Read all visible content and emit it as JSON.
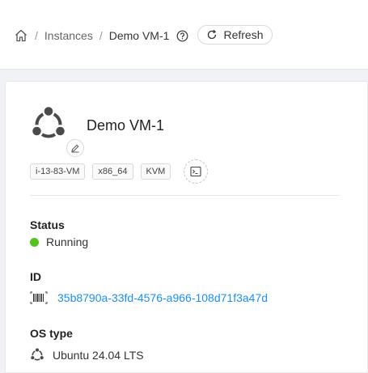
{
  "breadcrumb": {
    "home_icon": "home-icon",
    "items": [
      "Instances",
      "Demo VM-1"
    ],
    "separator": "/"
  },
  "header": {
    "help_icon": "question-circle-icon",
    "refresh_label": "Refresh",
    "refresh_icon": "reload-icon"
  },
  "instance": {
    "name": "Demo VM-1",
    "os_icon": "ubuntu-logo",
    "tags": [
      "i-13-83-VM",
      "x86_64",
      "KVM"
    ],
    "console_icon": "terminal-icon",
    "edit_icon": "edit-icon"
  },
  "details": {
    "status_label": "Status",
    "status_value": "Running",
    "status_color": "#52c41a",
    "id_label": "ID",
    "id_value": "35b8790a-33fd-4576-a966-108d71f3a47d",
    "id_icon": "barcode-icon",
    "ostype_label": "OS type",
    "ostype_value": "Ubuntu 24.04 LTS"
  },
  "colors": {
    "accent": "#1890ff",
    "running": "#52c41a"
  }
}
